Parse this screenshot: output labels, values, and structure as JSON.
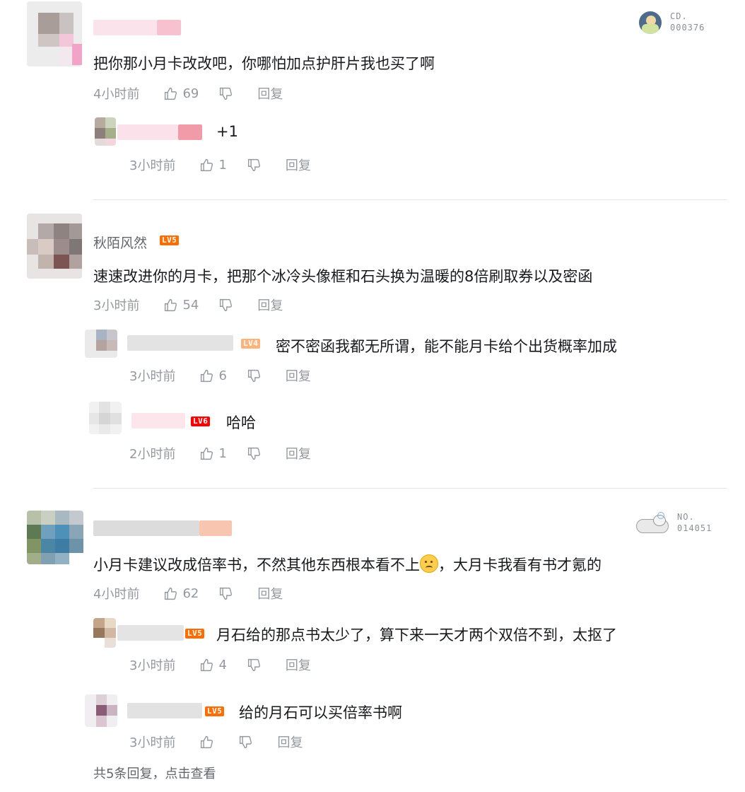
{
  "comments": [
    {
      "text": "把你那小月卡改改吧，你哪怕加点护肝片我也买了啊",
      "time": "4小时前",
      "likes": "69",
      "reply_label": "回复",
      "badge": {
        "line1": "CD.",
        "line2": "000376"
      },
      "replies": [
        {
          "text": "+1",
          "time": "3小时前",
          "likes": "1",
          "reply_label": "回复"
        }
      ]
    },
    {
      "username": "秋陌风然",
      "level": "LV5",
      "text": "速速改进你的月卡，把那个冰冷头像框和石头换为温暖的8倍刷取券以及密函",
      "time": "3小时前",
      "likes": "54",
      "reply_label": "回复",
      "replies": [
        {
          "level": "LV4",
          "text": "密不密函我都无所谓，能不能月卡给个出货概率加成",
          "time": "3小时前",
          "likes": "6",
          "reply_label": "回复"
        },
        {
          "level": "LV6",
          "text": "哈哈",
          "time": "2小时前",
          "likes": "1",
          "reply_label": "回复"
        }
      ]
    },
    {
      "text": "小月卡建议改成倍率书，不然其他东西根本看不上",
      "text_after_emoji": "，大月卡我看有书才氪的",
      "time": "4小时前",
      "likes": "62",
      "reply_label": "回复",
      "badge": {
        "line1": "NO.",
        "line2": "014051"
      },
      "replies": [
        {
          "level": "LV5",
          "text": "月石给的那点书太少了，算下来一天才两个双倍不到，太抠了",
          "time": "3小时前",
          "likes": "4",
          "reply_label": "回复"
        },
        {
          "level": "LV5",
          "text": "给的月石可以买倍率书啊",
          "time": "3小时前",
          "likes": "",
          "reply_label": "回复"
        }
      ],
      "more_replies": "共5条回复，点击查看"
    }
  ],
  "colors": {
    "lv4": "#ffb37c",
    "lv5": "#ff6c00",
    "lv6": "#ff0000",
    "meta": "#9499a0",
    "text": "#18191c"
  }
}
